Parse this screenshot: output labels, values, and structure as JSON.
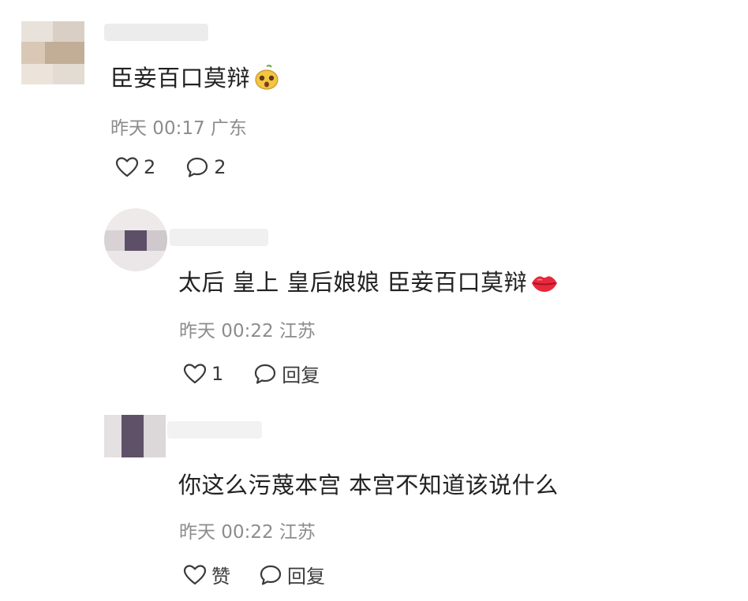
{
  "comments": [
    {
      "text": "臣妾百口莫辩",
      "emoji": "pear-face-emoji",
      "meta": "昨天 00:17 广东",
      "likes": "2",
      "reply": "2"
    },
    {
      "text": "太后 皇上 皇后娘娘 臣妾百口莫辩",
      "emoji": "lips-emoji",
      "meta": "昨天 00:22 江苏",
      "likes": "1",
      "reply": "回复"
    },
    {
      "text": "你这么污蔑本宫 本宫不知道该说什么",
      "meta": "昨天 00:22 江苏",
      "likes": "赞",
      "reply": "回复"
    }
  ],
  "colors": {
    "text": "#222222",
    "meta": "#8c8c8c",
    "icon": "#3a3a3a"
  }
}
